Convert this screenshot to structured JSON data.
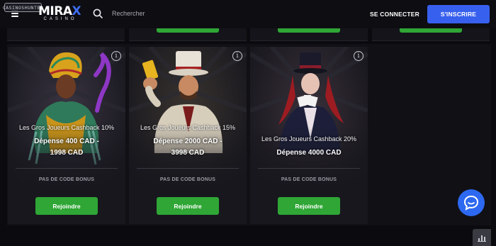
{
  "header": {
    "watermark": "CASINOSHUNTER",
    "logo_main_a": "MIRA",
    "logo_main_x": "X",
    "logo_sub": "CASINO",
    "search_placeholder": "Rechercher",
    "login_label": "SE CONNECTER",
    "signup_label": "S'INSCRIRE",
    "icons": [
      "hamburger-menu-icon",
      "search-icon"
    ],
    "accent_color": "#3860ee"
  },
  "cards": [
    {
      "cashback": "Les Gros Joueurs Cashback 10%",
      "spend_line1": "Dépense 400 CAD -",
      "spend_line2": "1998 CAD",
      "no_code": "PAS DE CODE BONUS",
      "join_label": "Rejoindre"
    },
    {
      "cashback": "Les Gros Joueurs Cashback 15%",
      "spend_line1": "Dépense 2000 CAD -",
      "spend_line2": "3998 CAD",
      "no_code": "PAS DE CODE BONUS",
      "join_label": "Rejoindre"
    },
    {
      "cashback": "Les Gros Joueurs Cashback 20%",
      "spend_line1": "Dépense 4000 CAD",
      "spend_line2": "",
      "no_code": "PAS DE CODE BONUS",
      "join_label": "Rejoindre"
    }
  ],
  "colors": {
    "join_green": "#2fa635",
    "chat_blue": "#2d68f0"
  },
  "widgets": {
    "chat_icon": "chat-bubble-icon",
    "corner_icon": "bar-chart-icon"
  }
}
